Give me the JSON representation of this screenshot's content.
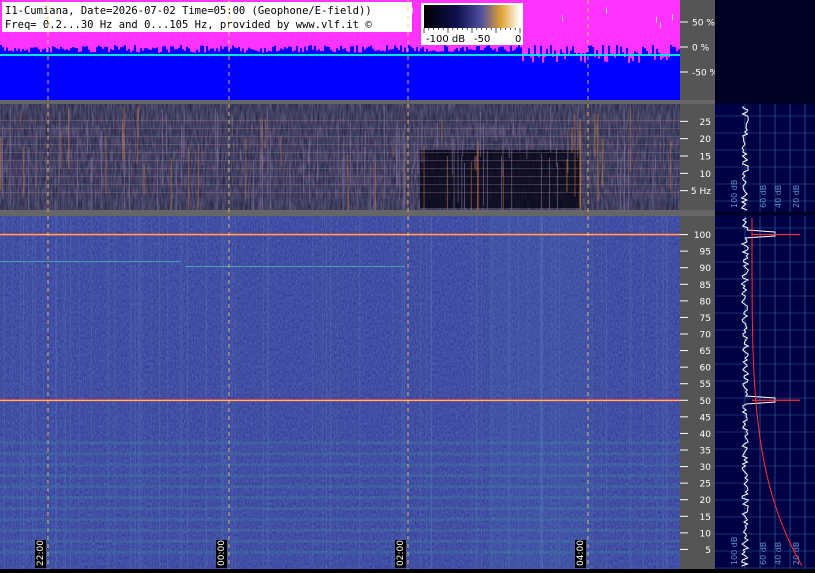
{
  "header": {
    "line1": "I1-Cumiana, Date=2026-07-02 Time=05:00 (Geophone/E-field))",
    "line2": "Freq= 0.2...30 Hz and 0...105 Hz, provided by www.vlf.it ©"
  },
  "colorbar": {
    "labels": [
      "-100 dB",
      "-50",
      "0"
    ]
  },
  "chart_data": [
    {
      "type": "line",
      "panel": "amplitude",
      "ylabel_ticks": [
        "50 %",
        "0 %",
        "-50 %"
      ],
      "yticks": [
        50,
        0,
        -50
      ],
      "ylim": [
        -100,
        100
      ],
      "series_colors": {
        "envelope": "#ff33ff",
        "baseline": "#00e5e5",
        "background": "#0000ff"
      }
    },
    {
      "type": "heatmap",
      "panel": "low-frequency-spectrogram",
      "ylim": [
        0,
        30
      ],
      "yticks": [
        5,
        10,
        15,
        20,
        25
      ],
      "ytick_labels": [
        "5 Hz",
        "10",
        "15",
        "20",
        "25"
      ]
    },
    {
      "type": "heatmap",
      "panel": "high-frequency-spectrogram",
      "ylim": [
        0,
        105
      ],
      "yticks": [
        5,
        10,
        15,
        20,
        25,
        30,
        35,
        40,
        45,
        50,
        55,
        60,
        65,
        70,
        75,
        80,
        85,
        90,
        95,
        100
      ],
      "ytick_labels": [
        "5",
        "10",
        "15",
        "20",
        "25",
        "30",
        "35",
        "40",
        "45",
        "50",
        "55",
        "60",
        "65",
        "70",
        "75",
        "80",
        "85",
        "90",
        "95",
        "100"
      ],
      "strong_lines_hz": [
        50,
        100
      ],
      "xticks": [
        "22:00",
        "00:00",
        "02:00",
        "04:00"
      ]
    },
    {
      "type": "line",
      "panel": "spectrum-low",
      "x_tick_labels": [
        "100 dB",
        "60 dB",
        "40 dB",
        "20 dB"
      ]
    },
    {
      "type": "line",
      "panel": "spectrum-high",
      "x_tick_labels": [
        "100 dB",
        "60 dB",
        "40 dB",
        "20 dB"
      ],
      "peak_hz": [
        50,
        100
      ]
    }
  ]
}
